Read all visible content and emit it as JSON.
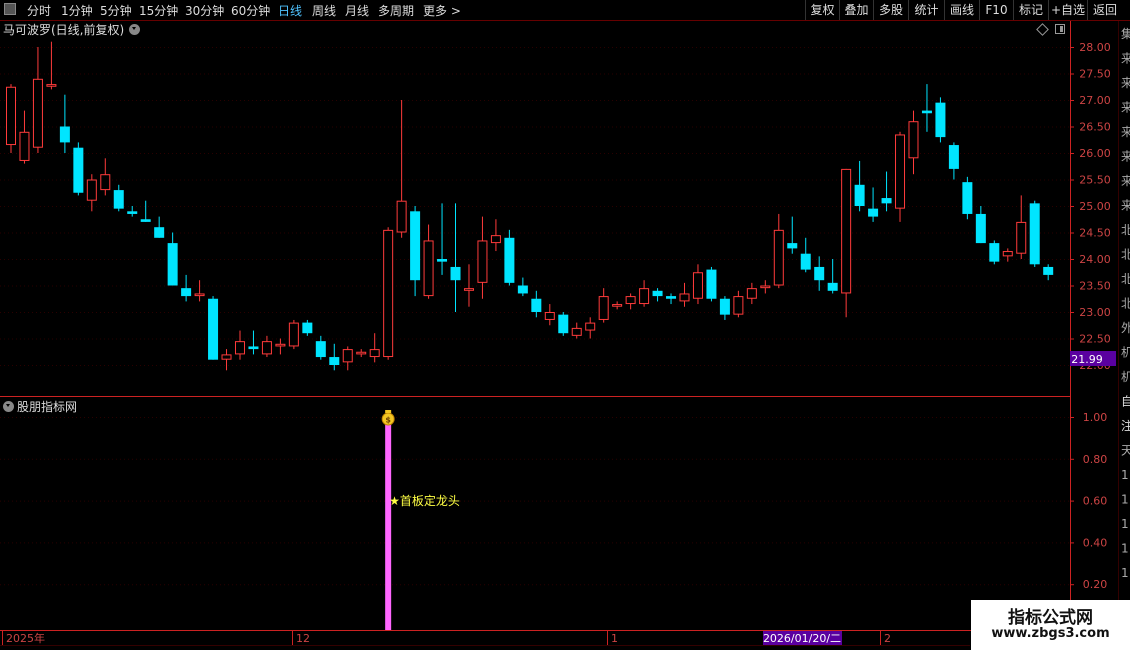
{
  "toolbar": {
    "periods": [
      "分时",
      "1分钟",
      "5分钟",
      "15分钟",
      "30分钟",
      "60分钟",
      "日线",
      "周线",
      "月线",
      "多周期",
      "更多 >"
    ],
    "active_period": "日线",
    "right_buttons": [
      "复权",
      "叠加",
      "多股",
      "统计",
      "画线",
      "F10",
      "标记",
      "+自选",
      "返回"
    ]
  },
  "main_title": "马可波罗(日线,前复权)",
  "sub_title": "股朋指标网",
  "current_price": "21.99",
  "annotation": "★首板定龙头",
  "date_marks": {
    "year": "2025年",
    "m12": "12",
    "m1": "1",
    "cursor_date": "2026/01/20/二",
    "m2": "2"
  },
  "watermark": {
    "title": "指标公式网",
    "url": "www.zbgs3.com"
  },
  "colors": {
    "up": "#ff3b3b",
    "down": "#00e5ff",
    "indicator_bar": "#ff66ff",
    "axis": "#cc2222",
    "annotation": "#ffff44",
    "price_tag_bg": "#5a00a0"
  },
  "right_edge_chars": [
    "集",
    "来",
    "来",
    "来",
    "来",
    "来",
    "来",
    "来",
    "北",
    "北",
    "北",
    "北",
    "外",
    "机",
    "机",
    "自",
    "注",
    "天",
    "1",
    "1",
    "1",
    "1",
    "1"
  ],
  "chart_data": [
    {
      "type": "candlestick",
      "title": "马可波罗(日线,前复权)",
      "y_ticks": [
        28.0,
        27.5,
        27.0,
        26.5,
        26.0,
        25.5,
        25.0,
        24.5,
        24.0,
        23.5,
        23.0,
        22.5,
        22.0
      ],
      "ylim": [
        21.6,
        28.2
      ],
      "candles": [
        {
          "o": 26.15,
          "h": 27.3,
          "l": 26.0,
          "c": 27.25
        },
        {
          "o": 25.85,
          "h": 26.8,
          "l": 25.8,
          "c": 26.4
        },
        {
          "o": 26.1,
          "h": 28.0,
          "l": 26.0,
          "c": 27.4
        },
        {
          "o": 27.25,
          "h": 28.1,
          "l": 27.2,
          "c": 27.3
        },
        {
          "o": 26.5,
          "h": 27.1,
          "l": 26.0,
          "c": 26.2
        },
        {
          "o": 26.1,
          "h": 26.2,
          "l": 25.2,
          "c": 25.25
        },
        {
          "o": 25.1,
          "h": 25.6,
          "l": 24.9,
          "c": 25.5
        },
        {
          "o": 25.3,
          "h": 25.9,
          "l": 25.2,
          "c": 25.6
        },
        {
          "o": 25.3,
          "h": 25.4,
          "l": 24.9,
          "c": 24.95
        },
        {
          "o": 24.9,
          "h": 25.0,
          "l": 24.8,
          "c": 24.85
        },
        {
          "o": 24.75,
          "h": 25.1,
          "l": 24.7,
          "c": 24.7
        },
        {
          "o": 24.6,
          "h": 24.8,
          "l": 24.4,
          "c": 24.4
        },
        {
          "o": 24.3,
          "h": 24.5,
          "l": 23.5,
          "c": 23.5
        },
        {
          "o": 23.45,
          "h": 23.7,
          "l": 23.2,
          "c": 23.3
        },
        {
          "o": 23.3,
          "h": 23.6,
          "l": 23.2,
          "c": 23.35
        },
        {
          "o": 23.25,
          "h": 23.3,
          "l": 22.1,
          "c": 22.1
        },
        {
          "o": 22.1,
          "h": 22.3,
          "l": 21.9,
          "c": 22.2
        },
        {
          "o": 22.2,
          "h": 22.65,
          "l": 22.1,
          "c": 22.45
        },
        {
          "o": 22.35,
          "h": 22.65,
          "l": 22.2,
          "c": 22.3
        },
        {
          "o": 22.2,
          "h": 22.55,
          "l": 22.15,
          "c": 22.45
        },
        {
          "o": 22.35,
          "h": 22.5,
          "l": 22.2,
          "c": 22.4
        },
        {
          "o": 22.35,
          "h": 22.85,
          "l": 22.3,
          "c": 22.8
        },
        {
          "o": 22.8,
          "h": 22.85,
          "l": 22.55,
          "c": 22.6
        },
        {
          "o": 22.45,
          "h": 22.55,
          "l": 22.1,
          "c": 22.15
        },
        {
          "o": 22.15,
          "h": 22.4,
          "l": 21.9,
          "c": 22.0
        },
        {
          "o": 22.05,
          "h": 22.35,
          "l": 21.9,
          "c": 22.3
        },
        {
          "o": 22.2,
          "h": 22.3,
          "l": 22.15,
          "c": 22.25
        },
        {
          "o": 22.15,
          "h": 22.6,
          "l": 22.05,
          "c": 22.3
        },
        {
          "o": 22.15,
          "h": 24.6,
          "l": 22.1,
          "c": 24.55
        },
        {
          "o": 24.5,
          "h": 27.0,
          "l": 24.4,
          "c": 25.1
        },
        {
          "o": 24.9,
          "h": 25.0,
          "l": 23.3,
          "c": 23.6
        },
        {
          "o": 23.3,
          "h": 24.65,
          "l": 23.25,
          "c": 24.35
        },
        {
          "o": 24.0,
          "h": 25.05,
          "l": 23.7,
          "c": 23.95
        },
        {
          "o": 23.85,
          "h": 25.05,
          "l": 23.0,
          "c": 23.6
        },
        {
          "o": 23.4,
          "h": 23.9,
          "l": 23.1,
          "c": 23.45
        },
        {
          "o": 23.55,
          "h": 24.8,
          "l": 23.25,
          "c": 24.35
        },
        {
          "o": 24.3,
          "h": 24.75,
          "l": 24.15,
          "c": 24.45
        },
        {
          "o": 24.4,
          "h": 24.55,
          "l": 23.5,
          "c": 23.55
        },
        {
          "o": 23.5,
          "h": 23.65,
          "l": 23.3,
          "c": 23.35
        },
        {
          "o": 23.25,
          "h": 23.4,
          "l": 22.9,
          "c": 23.0
        },
        {
          "o": 22.85,
          "h": 23.15,
          "l": 22.75,
          "c": 23.0
        },
        {
          "o": 22.95,
          "h": 23.0,
          "l": 22.55,
          "c": 22.6
        },
        {
          "o": 22.55,
          "h": 22.8,
          "l": 22.5,
          "c": 22.7
        },
        {
          "o": 22.65,
          "h": 22.9,
          "l": 22.5,
          "c": 22.8
        },
        {
          "o": 22.85,
          "h": 23.45,
          "l": 22.8,
          "c": 23.3
        },
        {
          "o": 23.1,
          "h": 23.2,
          "l": 23.05,
          "c": 23.15
        },
        {
          "o": 23.15,
          "h": 23.35,
          "l": 23.05,
          "c": 23.3
        },
        {
          "o": 23.15,
          "h": 23.6,
          "l": 23.1,
          "c": 23.45
        },
        {
          "o": 23.4,
          "h": 23.45,
          "l": 23.2,
          "c": 23.3
        },
        {
          "o": 23.3,
          "h": 23.35,
          "l": 23.15,
          "c": 23.25
        },
        {
          "o": 23.2,
          "h": 23.55,
          "l": 23.1,
          "c": 23.35
        },
        {
          "o": 23.25,
          "h": 23.9,
          "l": 23.15,
          "c": 23.75
        },
        {
          "o": 23.8,
          "h": 23.85,
          "l": 23.2,
          "c": 23.25
        },
        {
          "o": 23.25,
          "h": 23.3,
          "l": 22.85,
          "c": 22.95
        },
        {
          "o": 22.95,
          "h": 23.4,
          "l": 22.9,
          "c": 23.3
        },
        {
          "o": 23.25,
          "h": 23.55,
          "l": 23.15,
          "c": 23.45
        },
        {
          "o": 23.45,
          "h": 23.6,
          "l": 23.35,
          "c": 23.5
        },
        {
          "o": 23.5,
          "h": 24.85,
          "l": 23.45,
          "c": 24.55
        },
        {
          "o": 24.3,
          "h": 24.8,
          "l": 24.1,
          "c": 24.2
        },
        {
          "o": 24.1,
          "h": 24.4,
          "l": 23.75,
          "c": 23.8
        },
        {
          "o": 23.85,
          "h": 24.05,
          "l": 23.4,
          "c": 23.6
        },
        {
          "o": 23.55,
          "h": 24.0,
          "l": 23.35,
          "c": 23.4
        },
        {
          "o": 23.35,
          "h": 25.7,
          "l": 22.9,
          "c": 25.7
        },
        {
          "o": 25.4,
          "h": 25.85,
          "l": 24.9,
          "c": 25.0
        },
        {
          "o": 24.95,
          "h": 25.35,
          "l": 24.7,
          "c": 24.8
        },
        {
          "o": 25.15,
          "h": 25.65,
          "l": 24.9,
          "c": 25.05
        },
        {
          "o": 24.95,
          "h": 26.4,
          "l": 24.7,
          "c": 26.35
        },
        {
          "o": 25.9,
          "h": 26.8,
          "l": 25.6,
          "c": 26.6
        },
        {
          "o": 26.8,
          "h": 27.3,
          "l": 26.4,
          "c": 26.75
        },
        {
          "o": 26.95,
          "h": 27.05,
          "l": 26.2,
          "c": 26.3
        },
        {
          "o": 26.15,
          "h": 26.2,
          "l": 25.5,
          "c": 25.7
        },
        {
          "o": 25.45,
          "h": 25.55,
          "l": 24.75,
          "c": 24.85
        },
        {
          "o": 24.85,
          "h": 25.0,
          "l": 24.3,
          "c": 24.3
        },
        {
          "o": 24.3,
          "h": 24.35,
          "l": 23.9,
          "c": 23.95
        },
        {
          "o": 24.05,
          "h": 24.2,
          "l": 23.95,
          "c": 24.15
        },
        {
          "o": 24.1,
          "h": 25.2,
          "l": 24.0,
          "c": 24.7
        },
        {
          "o": 25.05,
          "h": 25.1,
          "l": 23.85,
          "c": 23.9
        },
        {
          "o": 23.85,
          "h": 23.9,
          "l": 23.6,
          "c": 23.7
        }
      ]
    },
    {
      "type": "bar",
      "title": "股朋指标网",
      "y_ticks": [
        1.0,
        0.8,
        0.6,
        0.4,
        0.2
      ],
      "ylim": [
        0,
        1.05
      ],
      "signal_index": 28,
      "value": 1.0,
      "label": "★首板定龙头"
    }
  ]
}
